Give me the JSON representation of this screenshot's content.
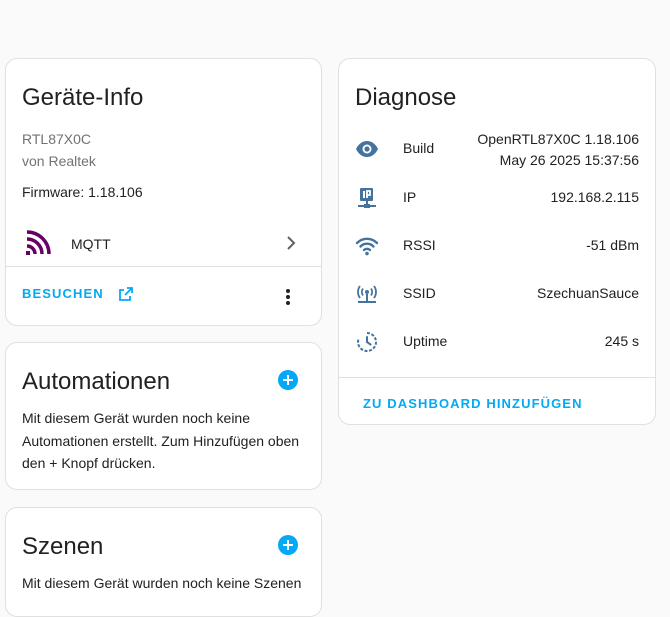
{
  "colors": {
    "accent": "#03a9f4",
    "icon": "#44739e",
    "mqtt": "#660066"
  },
  "device_info": {
    "title": "Geräte-Info",
    "model": "RTL87X0C",
    "manufacturer": "von Realtek",
    "firmware": "Firmware: 1.18.106",
    "integration": {
      "icon": "mqtt-icon",
      "label": "MQTT"
    },
    "visit_label": "BESUCHEN"
  },
  "automations": {
    "title": "Automationen",
    "text": "Mit diesem Gerät wurden noch keine Automationen erstellt. Zum Hinzufügen oben den + Knopf drücken."
  },
  "scenes": {
    "title": "Szenen",
    "text": "Mit diesem Gerät wurden noch keine Szenen"
  },
  "diagnose": {
    "title": "Diagnose",
    "rows": [
      {
        "icon": "eye-icon",
        "label": "Build",
        "value_line1": "OpenRTL87X0C 1.18.106",
        "value_line2": "May 26 2025 15:37:56"
      },
      {
        "icon": "ip-network-icon",
        "label": "IP",
        "value": "192.168.2.115"
      },
      {
        "icon": "wifi-icon",
        "label": "RSSI",
        "value": "-51 dBm"
      },
      {
        "icon": "access-point-icon",
        "label": "SSID",
        "value": "SzechuanSauce"
      },
      {
        "icon": "timer-icon",
        "label": "Uptime",
        "value": "245 s"
      }
    ],
    "add_to_dashboard": "ZU DASHBOARD HINZUFÜGEN"
  }
}
